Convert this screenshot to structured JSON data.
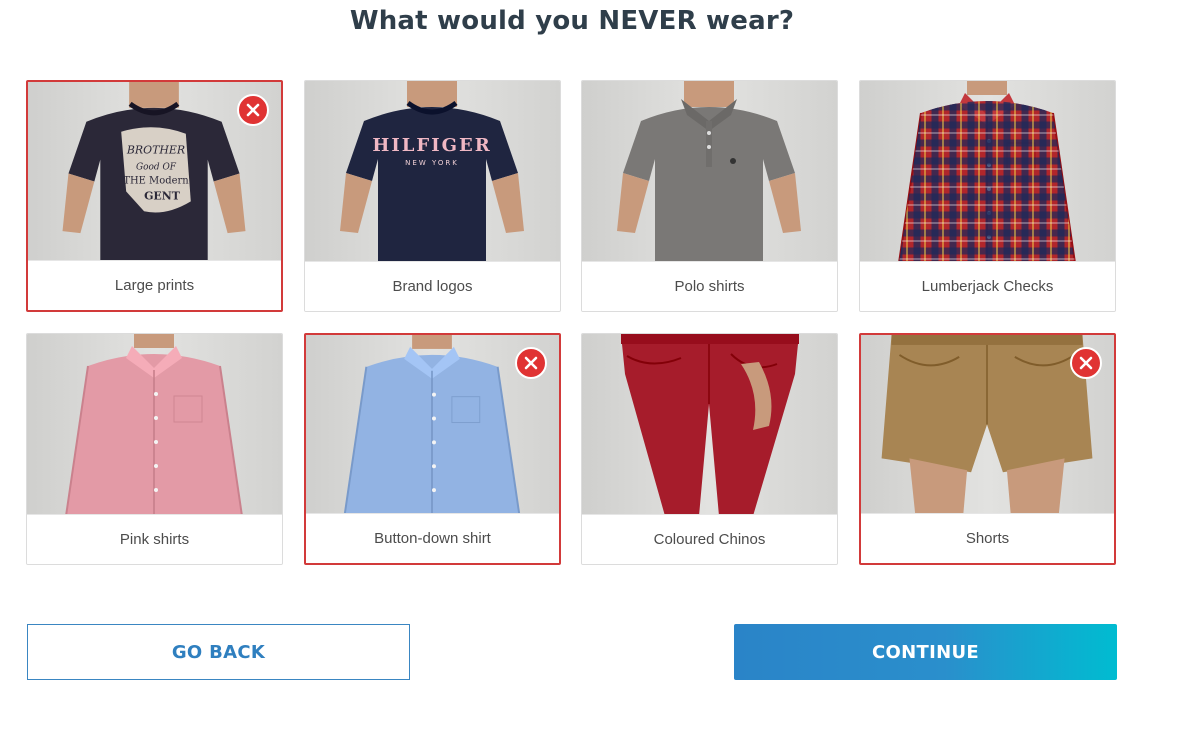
{
  "page": {
    "title": "What would you NEVER wear?"
  },
  "items": [
    {
      "label": "Large prints",
      "selected": true,
      "garment": "tshirt",
      "color": "#2b2838",
      "print": "BROTHER Good OF THE Modern GENT"
    },
    {
      "label": "Brand logos",
      "selected": false,
      "garment": "tshirt",
      "color": "#1f2540",
      "print": "HILFIGER",
      "print_sub": "NEW YORK"
    },
    {
      "label": "Polo shirts",
      "selected": false,
      "garment": "polo",
      "color": "#7a7876"
    },
    {
      "label": "Lumberjack Checks",
      "selected": false,
      "garment": "shirt-check",
      "color": "#b1262b"
    },
    {
      "label": "Pink shirts",
      "selected": false,
      "garment": "shirt",
      "color": "#e39aa6"
    },
    {
      "label": "Button-down shirt",
      "selected": true,
      "garment": "shirt",
      "color": "#92b3e3"
    },
    {
      "label": "Coloured Chinos",
      "selected": false,
      "garment": "chinos",
      "color": "#a61c2b"
    },
    {
      "label": "Shorts",
      "selected": true,
      "garment": "shorts",
      "color": "#a88553"
    }
  ],
  "buttons": {
    "back": "GO BACK",
    "continue": "CONTINUE"
  },
  "icons": {
    "remove": "close-circle-icon"
  },
  "colors": {
    "selected_border": "#d23a3a",
    "accent": "#2a84c8",
    "title": "#2f3e4a"
  }
}
